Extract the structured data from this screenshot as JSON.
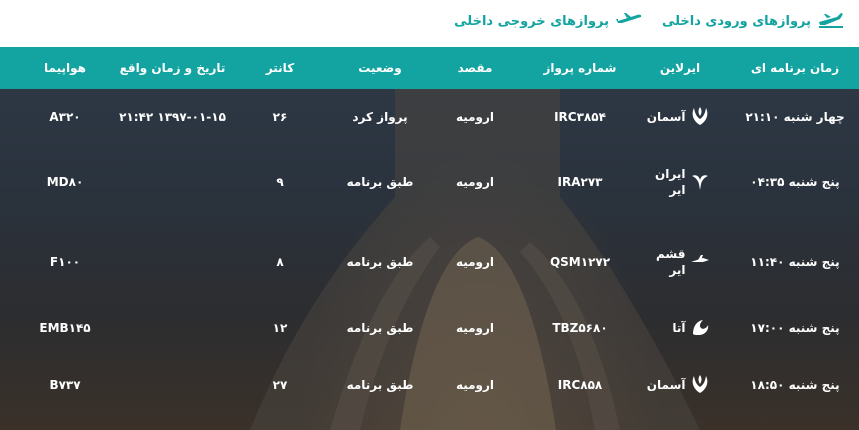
{
  "nav": {
    "arrivals_label": "پروازهای ورودی داخلی",
    "departures_label": "پروازهای خروجی داخلی"
  },
  "table": {
    "headers": {
      "scheduled": "زمان برنامه ای",
      "airline": "ایرلاین",
      "flight": "شماره پرواز",
      "destination": "مقصد",
      "status": "وضعیت",
      "counter": "کانتر",
      "actual": "تاریخ و زمان واقع",
      "aircraft": "هواپیما"
    },
    "rows": [
      {
        "scheduled": "چهار شنبه ۲۱:۱۰",
        "airline": "آسمان",
        "logo": "aseman-logo-icon",
        "flight": "IRC۳۸۵۴",
        "destination": "ارومیه",
        "status": "پرواز کرد",
        "counter": "۲۶",
        "actual": "۱۳۹۷-۰۱-۱۵ ۲۱:۴۲",
        "aircraft": "A۳۲۰"
      },
      {
        "scheduled": "پنج شنبه ۰۴:۳۵",
        "airline": "ایران ایر",
        "logo": "iran-air-logo-icon",
        "flight": "IRA۲۷۳",
        "destination": "ارومیه",
        "status": "طبق برنامه",
        "counter": "۹",
        "actual": "",
        "aircraft": "MD۸۰"
      },
      {
        "scheduled": "پنج شنبه ۱۱:۴۰",
        "airline": "قشم ایر",
        "logo": "qeshm-air-logo-icon",
        "flight": "QSM۱۲۷۲",
        "destination": "ارومیه",
        "status": "طبق برنامه",
        "counter": "۸",
        "actual": "",
        "aircraft": "F۱۰۰"
      },
      {
        "scheduled": "پنج شنبه ۱۷:۰۰",
        "airline": "آتا",
        "logo": "ata-logo-icon",
        "flight": "TBZ۵۶۸۰",
        "destination": "ارومیه",
        "status": "طبق برنامه",
        "counter": "۱۲",
        "actual": "",
        "aircraft": "EMB۱۴۵"
      },
      {
        "scheduled": "پنج شنبه ۱۸:۵۰",
        "airline": "آسمان",
        "logo": "aseman-logo-icon",
        "flight": "IRC۸۵۸",
        "destination": "ارومیه",
        "status": "طبق برنامه",
        "counter": "۲۷",
        "actual": "",
        "aircraft": "B۷۳۷"
      }
    ]
  },
  "colors": {
    "accent": "#13a3a0",
    "header_text": "#ffffff"
  }
}
